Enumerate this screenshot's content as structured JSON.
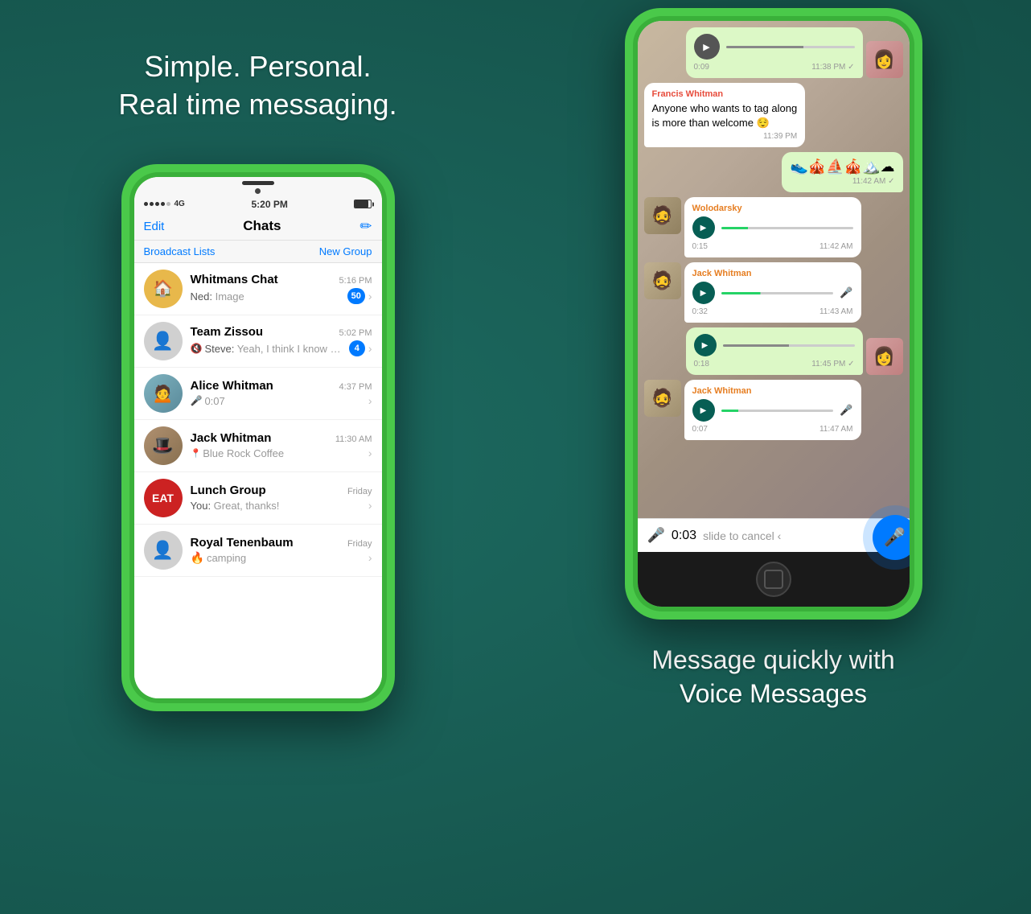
{
  "left": {
    "tagline": "Simple. Personal.\nReal time messaging.",
    "status_bar": {
      "dots": 5,
      "network": "4G",
      "time": "5:20 PM"
    },
    "nav": {
      "edit": "Edit",
      "title": "Chats",
      "compose": "✏"
    },
    "broadcast": {
      "lists": "Broadcast Lists",
      "new_group": "New Group"
    },
    "chats": [
      {
        "name": "Whitmans Chat",
        "time": "5:16 PM",
        "preview_prefix": "Ned:",
        "preview": "Image",
        "badge": "50",
        "avatar_type": "whitmans"
      },
      {
        "name": "Team Zissou",
        "time": "5:02 PM",
        "preview_prefix": "Steve:",
        "preview": "Yeah, I think I know wha...",
        "badge": "4",
        "muted": true,
        "avatar_type": "team"
      },
      {
        "name": "Alice Whitman",
        "time": "4:37 PM",
        "preview": "🎤 0:07",
        "avatar_type": "alice"
      },
      {
        "name": "Jack Whitman",
        "time": "11:30 AM",
        "preview": "📍 Blue Rock Coffee",
        "avatar_type": "jack"
      },
      {
        "name": "Lunch Group",
        "time": "Friday",
        "preview_prefix": "You:",
        "preview": "Great, thanks!",
        "avatar_type": "lunch"
      },
      {
        "name": "Royal Tenenbaum",
        "time": "Friday",
        "preview": "camping",
        "avatar_type": "royal"
      }
    ]
  },
  "right": {
    "messages": [
      {
        "type": "voice_received",
        "duration": "0:09",
        "time": "11:38 PM",
        "check": true,
        "has_avatar": true,
        "avatar_type": "woman"
      },
      {
        "type": "text_received",
        "sender": "Francis Whitman",
        "sender_color": "#e74c3c",
        "text": "Anyone who wants to tag along\nis more than welcome 😌",
        "time": "11:39 PM"
      },
      {
        "type": "emoji_sent",
        "text": "👟🎪⛵🎪🏔️☁",
        "time": "11:42 AM",
        "check": true
      },
      {
        "type": "voice_received_avatar",
        "sender": "Wolodarsky",
        "sender_color": "#e67e22",
        "duration": "0:15",
        "time": "11:42 AM",
        "has_avatar": true,
        "avatar_type": "man_glasses"
      },
      {
        "type": "voice_received_avatar",
        "sender": "Jack Whitman",
        "sender_color": "#e67e22",
        "duration": "0:32",
        "time": "11:43 AM",
        "has_avatar": true,
        "avatar_type": "man_moustache",
        "mic": true
      },
      {
        "type": "voice_sent",
        "duration": "0:18",
        "time": "11:45 PM",
        "check": true,
        "has_avatar": true,
        "avatar_type": "woman2"
      },
      {
        "type": "voice_received_avatar",
        "sender": "Jack Whitman",
        "sender_color": "#e67e22",
        "duration": "0:07",
        "time": "11:47 AM",
        "has_avatar": true,
        "avatar_type": "man_moustache2",
        "mic": true
      }
    ],
    "recording": {
      "time": "0:03",
      "slide_label": "slide to cancel ‹"
    },
    "bottom_tagline": "Message quickly with\nVoice Messages"
  }
}
